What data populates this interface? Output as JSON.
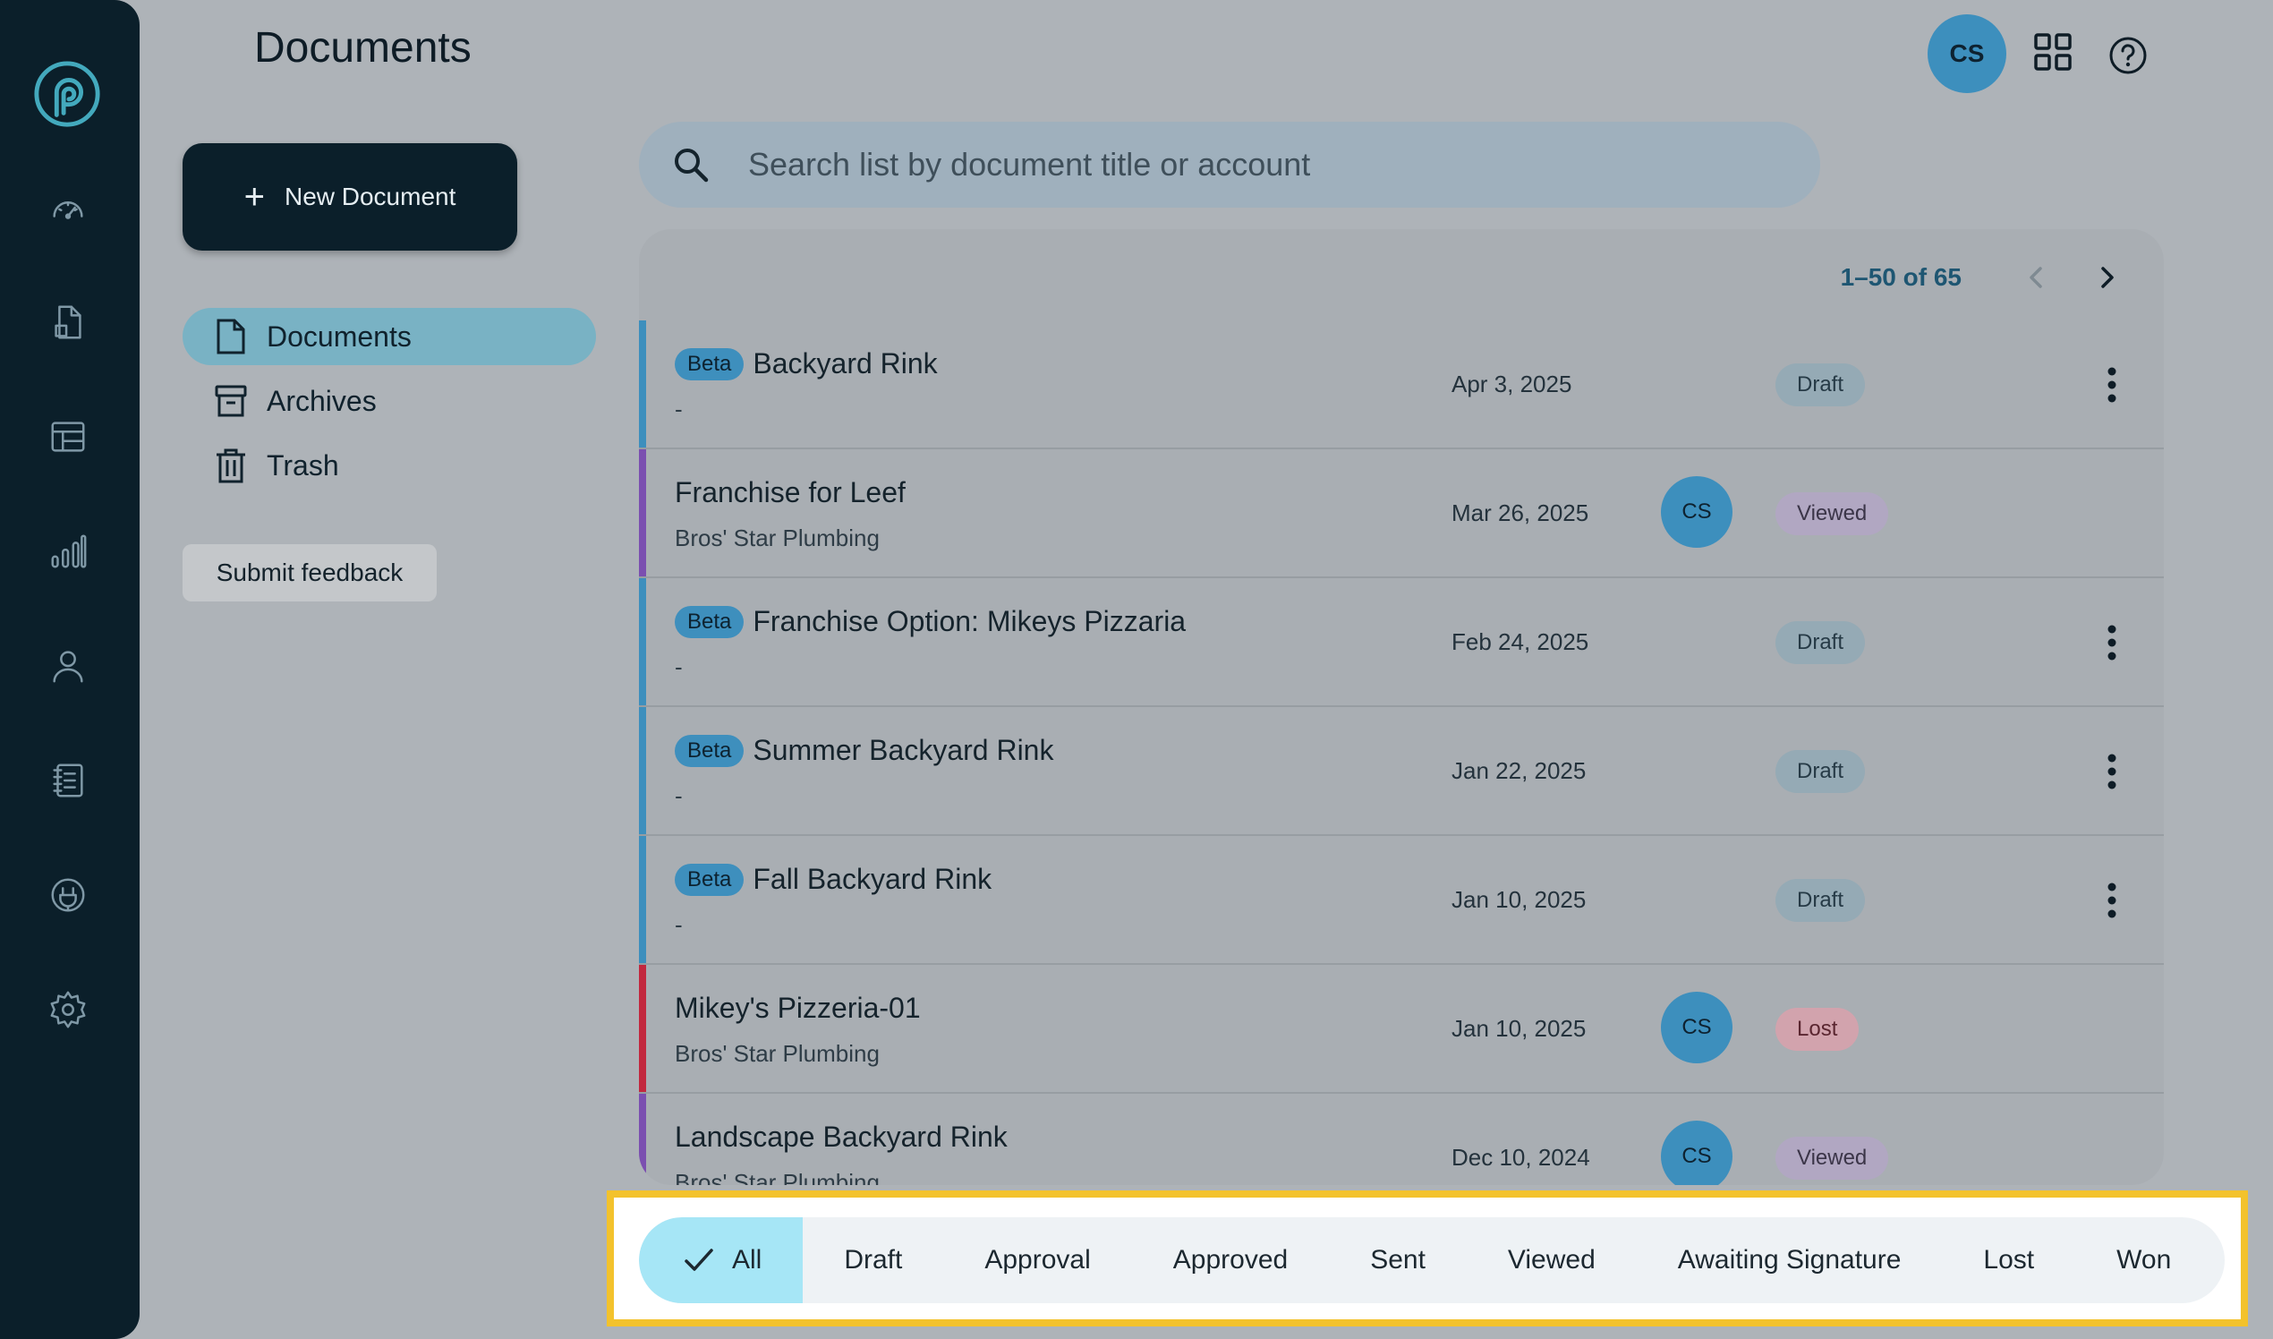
{
  "page_title": "Documents",
  "header": {
    "avatar_initials": "CS"
  },
  "new_document_label": "New Document",
  "side_nav": {
    "documents": "Documents",
    "archives": "Archives",
    "trash": "Trash"
  },
  "feedback_label": "Submit feedback",
  "search": {
    "placeholder": "Search list by document title or account"
  },
  "pagination": {
    "range": "1–50 of 65"
  },
  "documents": [
    {
      "badge": "Beta",
      "title": "Backyard Rink",
      "subtitle": "-",
      "date": "Apr 3, 2025",
      "avatar": "",
      "status": "Draft",
      "accent": "#3d8fbd"
    },
    {
      "badge": "",
      "title": "Franchise for Leef",
      "subtitle": "Bros' Star Plumbing",
      "date": "Mar 26, 2025",
      "avatar": "CS",
      "status": "Viewed",
      "accent": "#7b4fb0"
    },
    {
      "badge": "Beta",
      "title": "Franchise Option: Mikeys Pizzaria",
      "subtitle": "-",
      "date": "Feb 24, 2025",
      "avatar": "",
      "status": "Draft",
      "accent": "#3d8fbd"
    },
    {
      "badge": "Beta",
      "title": "Summer Backyard Rink",
      "subtitle": "-",
      "date": "Jan 22, 2025",
      "avatar": "",
      "status": "Draft",
      "accent": "#3d8fbd"
    },
    {
      "badge": "Beta",
      "title": "Fall Backyard Rink",
      "subtitle": "-",
      "date": "Jan 10, 2025",
      "avatar": "",
      "status": "Draft",
      "accent": "#3d8fbd"
    },
    {
      "badge": "",
      "title": "Mikey's Pizzeria-01",
      "subtitle": "Bros' Star Plumbing",
      "date": "Jan 10, 2025",
      "avatar": "CS",
      "status": "Lost",
      "accent": "#c2283e"
    },
    {
      "badge": "",
      "title": "Landscape Backyard Rink",
      "subtitle": "Bros' Star Plumbing",
      "date": "Dec 10, 2024",
      "avatar": "CS",
      "status": "Viewed",
      "accent": "#7b4fb0"
    }
  ],
  "filters": {
    "all": "All",
    "draft": "Draft",
    "approval": "Approval",
    "approved": "Approved",
    "sent": "Sent",
    "viewed": "Viewed",
    "awaiting_signature": "Awaiting Signature",
    "lost": "Lost",
    "won": "Won"
  }
}
